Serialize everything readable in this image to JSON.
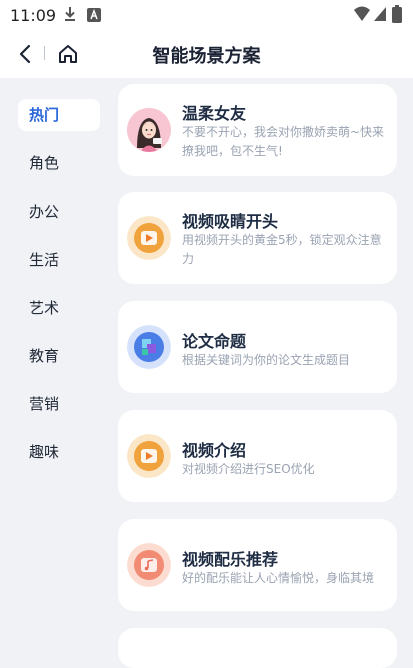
{
  "status_bar": {
    "time": "11:09",
    "icons": [
      "download-icon",
      "font-a-icon",
      "wifi-icon",
      "signal-icon",
      "battery-icon"
    ]
  },
  "nav": {
    "title": "智能场景方案",
    "back_icon": "back-chevron-icon",
    "home_icon": "home-icon"
  },
  "sidebar": {
    "items": [
      {
        "label": "热门",
        "active": true
      },
      {
        "label": "角色"
      },
      {
        "label": "办公"
      },
      {
        "label": "生活"
      },
      {
        "label": "艺术"
      },
      {
        "label": "教育"
      },
      {
        "label": "营销"
      },
      {
        "label": "趣味"
      }
    ]
  },
  "cards": [
    {
      "title": "温柔女友",
      "desc": "不要不开心，我会对你撒娇卖萌~快来撩我吧，包不生气!",
      "icon": "girl-avatar-icon"
    },
    {
      "title": "视频吸睛开头",
      "desc": "用视频开头的黄金5秒，锁定观众注意力",
      "icon": "video-play-icon"
    },
    {
      "title": "论文命题",
      "desc": "根据关键词为你的论文生成题目",
      "icon": "paper-document-icon"
    },
    {
      "title": "视频介绍",
      "desc": "对视频介绍进行SEO优化",
      "icon": "video-play-icon"
    },
    {
      "title": "视频配乐推荐",
      "desc": "好的配乐能让人心情愉悦，身临其境",
      "icon": "music-note-icon"
    }
  ],
  "colors": {
    "accent": "#2b67d8",
    "background": "#f0f2f6",
    "card": "#ffffff",
    "video_icon": "#f0a23c",
    "paper_icon": "#4a7ee6"
  }
}
